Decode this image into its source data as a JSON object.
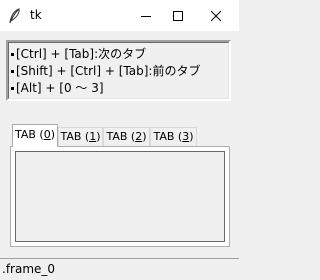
{
  "window": {
    "title": "tk",
    "icon": "feather-icon"
  },
  "titlebar_buttons": {
    "minimize_icon": "minimize-icon",
    "maximize_icon": "maximize-icon",
    "close_icon": "close-icon"
  },
  "info": {
    "lines": [
      "[Ctrl] + [Tab]:次のタブ",
      "[Shift] + [Ctrl] + [Tab]:前のタブ",
      "[Alt] + [0 ～ 3]"
    ]
  },
  "notebook": {
    "tabs": [
      {
        "label_prefix": "TAB (",
        "underline": "0",
        "label_suffix": ")",
        "selected": true
      },
      {
        "label_prefix": "TAB (",
        "underline": "1",
        "label_suffix": ")",
        "selected": false
      },
      {
        "label_prefix": "TAB (",
        "underline": "2",
        "label_suffix": ")",
        "selected": false
      },
      {
        "label_prefix": "TAB (",
        "underline": "3",
        "label_suffix": ")",
        "selected": false
      }
    ]
  },
  "status": {
    "text": ".frame_0"
  }
}
